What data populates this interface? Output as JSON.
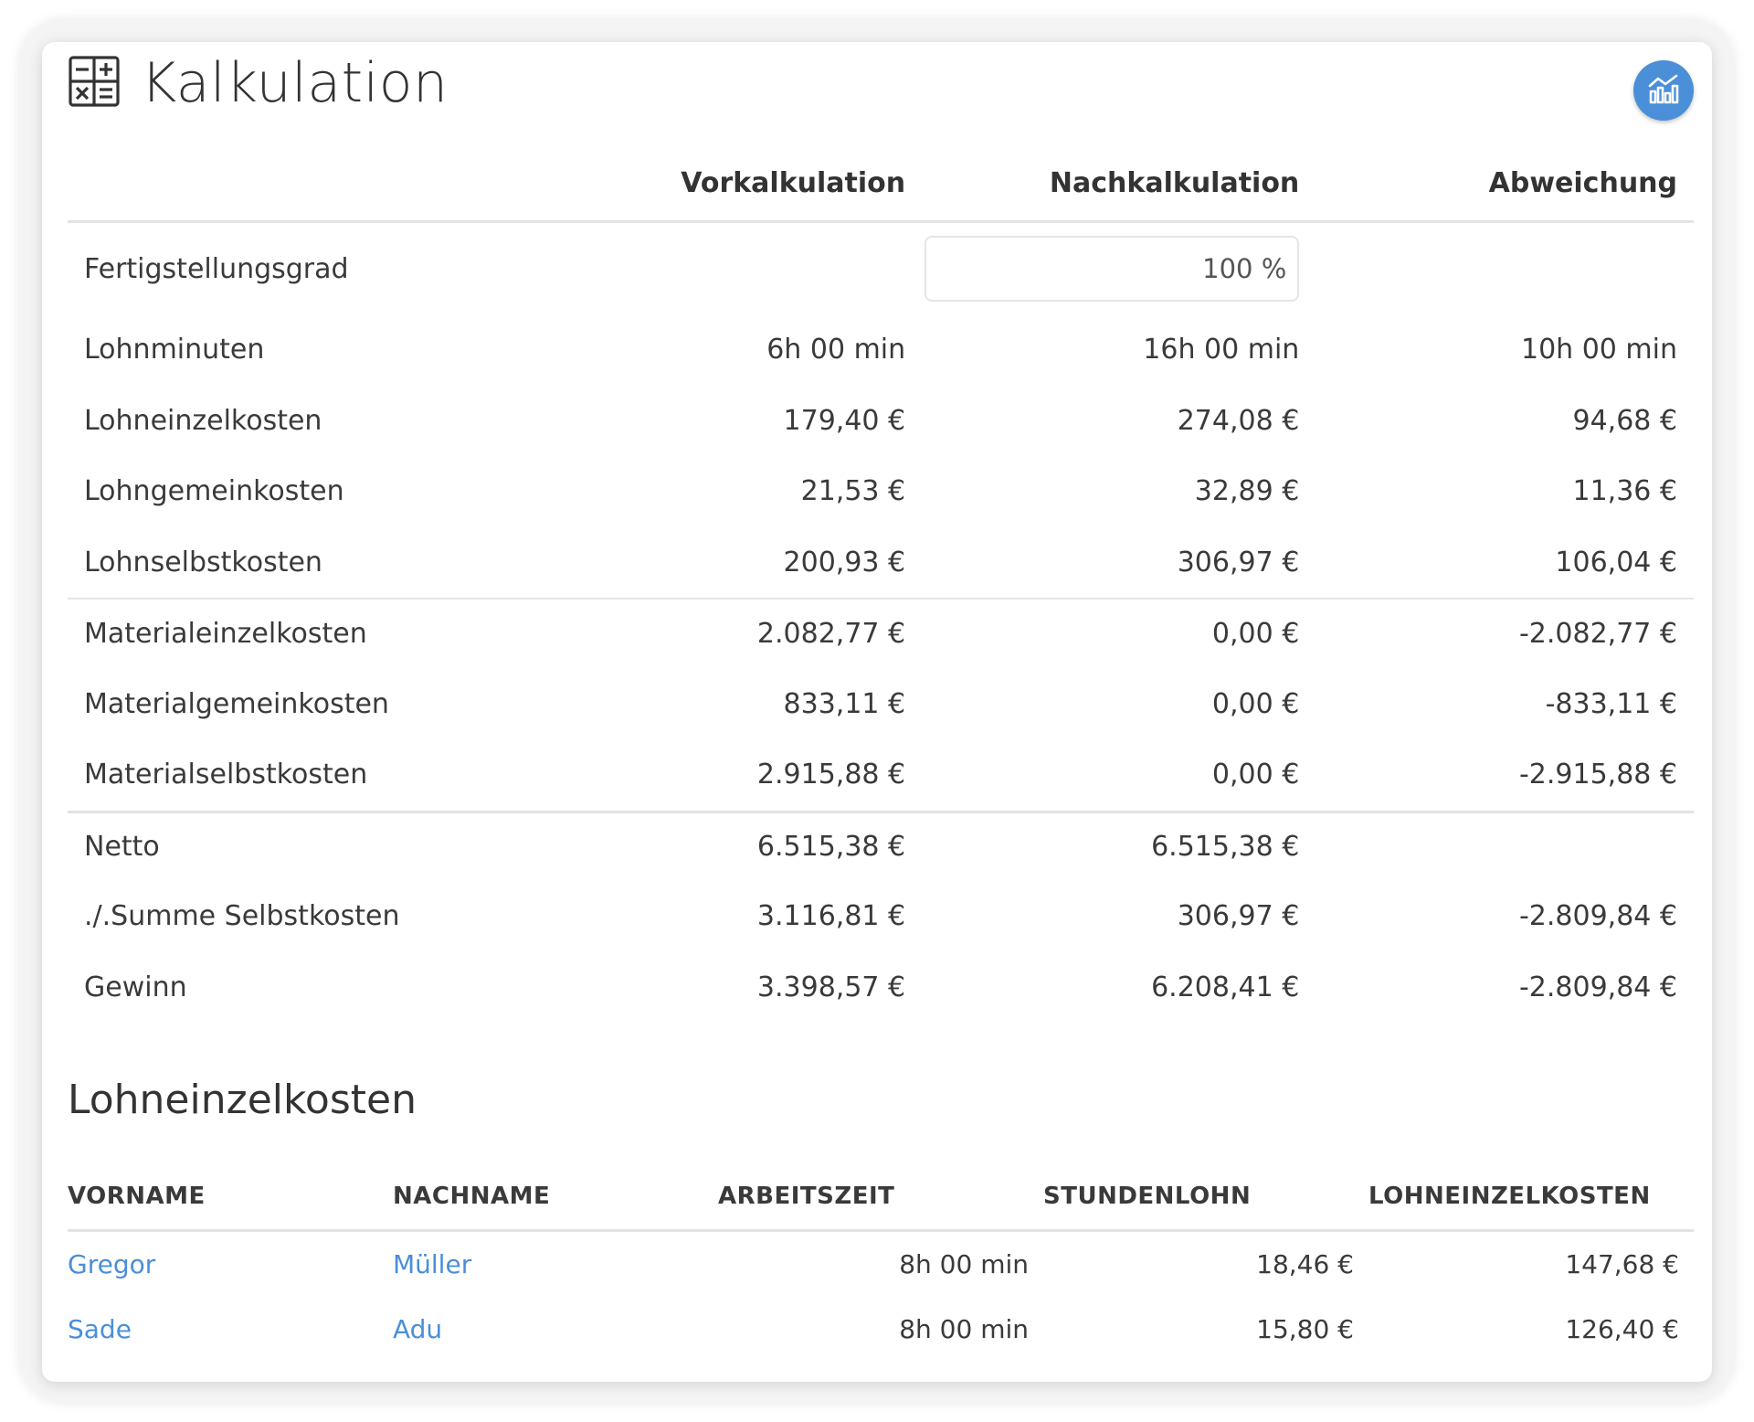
{
  "header": {
    "title": "Kalkulation",
    "title_icon": "calculator-icon",
    "chart_button_icon": "chart-icon",
    "accent_color": "#4a8fd8"
  },
  "kalkulation": {
    "columns": [
      "Vorkalkulation",
      "Nachkalkulation",
      "Abweichung"
    ],
    "fertigstellung": {
      "label": "Fertigstellungsgrad",
      "value": "100",
      "unit": "%"
    },
    "groups": [
      [
        {
          "label": "Lohnminuten",
          "vor": "6h 00 min",
          "nach": "16h 00 min",
          "abw": "10h 00 min"
        },
        {
          "label": "Lohneinzelkosten",
          "vor": "179,40 €",
          "nach": "274,08 €",
          "abw": "94,68 €"
        },
        {
          "label": "Lohngemeinkosten",
          "vor": "21,53 €",
          "nach": "32,89 €",
          "abw": "11,36 €"
        },
        {
          "label": "Lohnselbstkosten",
          "vor": "200,93 €",
          "nach": "306,97 €",
          "abw": "106,04 €"
        }
      ],
      [
        {
          "label": "Materialeinzelkosten",
          "vor": "2.082,77 €",
          "nach": "0,00 €",
          "abw": "-2.082,77 €"
        },
        {
          "label": "Materialgemeinkosten",
          "vor": "833,11 €",
          "nach": "0,00 €",
          "abw": "-833,11 €"
        },
        {
          "label": "Materialselbstkosten",
          "vor": "2.915,88 €",
          "nach": "0,00 €",
          "abw": "-2.915,88 €"
        }
      ],
      [
        {
          "label": "Netto",
          "vor": "6.515,38 €",
          "nach": "6.515,38 €",
          "abw": ""
        },
        {
          "label": "./.Summe Selbstkosten",
          "vor": "3.116,81 €",
          "nach": "306,97 €",
          "abw": "-2.809,84 €"
        },
        {
          "label": "Gewinn",
          "vor": "3.398,57 €",
          "nach": "6.208,41 €",
          "abw": "-2.809,84 €"
        }
      ]
    ]
  },
  "lohneinzelkosten": {
    "title": "Lohneinzelkosten",
    "columns": [
      "VORNAME",
      "NACHNAME",
      "ARBEITSZEIT",
      "STUNDENLOHN",
      "LOHNEINZELKOSTEN"
    ],
    "rows": [
      {
        "vorname": "Gregor",
        "nachname": "Müller",
        "arbeitszeit": "8h 00 min",
        "stundenlohn": "18,46 €",
        "kosten": "147,68 €"
      },
      {
        "vorname": "Sade",
        "nachname": "Adu",
        "arbeitszeit": "8h 00 min",
        "stundenlohn": "15,80 €",
        "kosten": "126,40 €"
      }
    ]
  }
}
